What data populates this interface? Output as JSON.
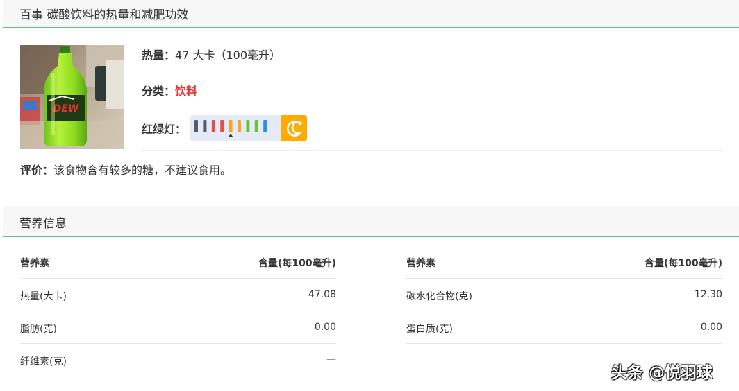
{
  "header": {
    "title": "百事 碳酸饮料的热量和减肥功效"
  },
  "product": {
    "image_name": "mountain-dew-bottle-photo",
    "calories": {
      "label": "热量：",
      "value": "47 大卡（100毫升）"
    },
    "category": {
      "label": "分类：",
      "value": "饮料",
      "color": "#e83232"
    },
    "traffic_light": {
      "label": "红绿灯：",
      "bar_colors": [
        "#555b66",
        "#555b66",
        "#e94e4e",
        "#e94e4e",
        "#f5a623",
        "#f5a623",
        "#6cbf3a",
        "#6cbf3a",
        "#2f8fe0"
      ],
      "selected_level_index": 4,
      "badge_icon": "moon-star-icon",
      "badge_color": "#ffab00"
    },
    "evaluation": {
      "label": "评价：",
      "text": "该食物含有较多的糖，不建议食用。"
    }
  },
  "nutrition": {
    "title": "营养信息",
    "left": {
      "header_name": "营养素",
      "header_value": "含量(每100毫升)",
      "rows": [
        {
          "name": "热量(大卡)",
          "value": "47.08"
        },
        {
          "name": "脂肪(克)",
          "value": "0.00"
        },
        {
          "name": "纤维素(克)",
          "value": "—"
        }
      ]
    },
    "right": {
      "header_name": "营养素",
      "header_value": "含量(每100毫升)",
      "rows": [
        {
          "name": "碳水化合物(克)",
          "value": "12.30"
        },
        {
          "name": "蛋白质(克)",
          "value": "0.00"
        }
      ]
    }
  },
  "watermark": {
    "text": "头条 @悦羽球"
  },
  "colors": {
    "accent_green": "#5ec185",
    "header_bg": "#f7f7f7"
  }
}
